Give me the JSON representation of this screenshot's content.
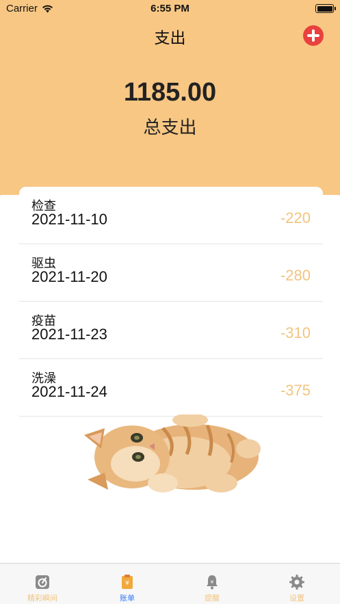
{
  "status_bar": {
    "carrier": "Carrier",
    "time": "6:55 PM"
  },
  "nav": {
    "title": "支出",
    "add_icon": "plus-circle-icon"
  },
  "summary": {
    "total": "1185.00",
    "label": "总支出"
  },
  "records": [
    {
      "name": "检查",
      "date": "2021-11-10",
      "amount": "-220"
    },
    {
      "name": "驱虫",
      "date": "2021-11-20",
      "amount": "-280"
    },
    {
      "name": "疫苗",
      "date": "2021-11-23",
      "amount": "-310"
    },
    {
      "name": "洗澡",
      "date": "2021-11-24",
      "amount": "-375"
    }
  ],
  "tabs": [
    {
      "label": "精彩瞬间",
      "icon": "camera-icon",
      "active": false
    },
    {
      "label": "账单",
      "icon": "bill-icon",
      "active": true
    },
    {
      "label": "提醒",
      "icon": "bell-icon",
      "active": false
    },
    {
      "label": "设置",
      "icon": "gear-icon",
      "active": false
    }
  ],
  "colors": {
    "header_bg": "#F8C784",
    "amount": "#F2C47E",
    "active_tab": "#3478F6",
    "add_button": "#E8413E"
  }
}
